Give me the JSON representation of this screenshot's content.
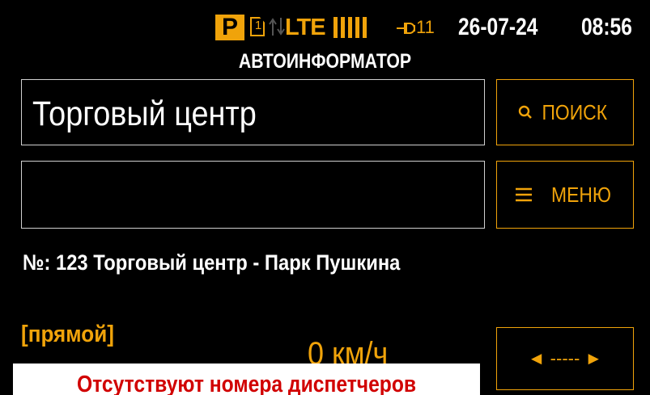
{
  "status": {
    "parking": "P",
    "sim_slot": "1",
    "network": "LTE",
    "signal_bars": 5,
    "satellites": "11",
    "date": "26-07-24",
    "time": "08:56"
  },
  "header": {
    "title": "АВТОИНФОРМАТОР"
  },
  "current_stop": "Торговый центр",
  "next_stop": "",
  "buttons": {
    "search": "ПОИСК",
    "menu": "МЕНЮ",
    "direction_switch": "◄ ----- ►"
  },
  "route": "№: 123 Торговый центр - Парк Пушкина",
  "direction": "[прямой]",
  "speed": "0 км/ч",
  "notification": "Отсутствуют номера диспетчеров",
  "colors": {
    "accent": "#f0a30a",
    "background": "#000000",
    "error": "#d10000"
  }
}
